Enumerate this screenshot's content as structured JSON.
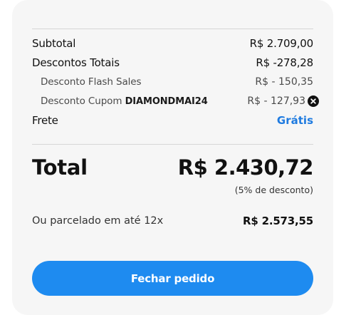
{
  "summary": {
    "subtotal_label": "Subtotal",
    "subtotal_value": "R$ 2.709,00",
    "discounts_label": "Descontos Totais",
    "discounts_value": "R$ -278,28",
    "flash_label": "Desconto Flash Sales",
    "flash_value": "R$ - 150,35",
    "coupon_label": "Desconto Cupom",
    "coupon_code": "DIAMONDMAI24",
    "coupon_value": "R$ - 127,93",
    "shipping_label": "Frete",
    "shipping_value": "Grátis",
    "total_label": "Total",
    "total_value": "R$ 2.430,72",
    "discount_note": "(5% de desconto)",
    "installment_label": "Ou parcelado em até 12x",
    "installment_value": "R$ 2.573,55"
  },
  "actions": {
    "checkout_label": "Fechar pedido"
  },
  "colors": {
    "accent": "#1e8bf0",
    "link": "#1f7be0",
    "card_bg": "#f6f6f6"
  },
  "icons": {
    "remove_coupon": "close-circle-icon"
  }
}
